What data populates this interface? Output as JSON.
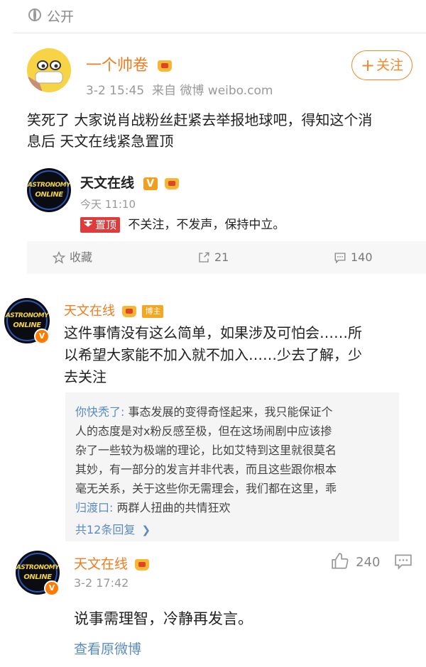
{
  "visibility": {
    "label": "公开"
  },
  "post": {
    "author": "一个帅卷",
    "time": "3-2 15:45",
    "source": "来自 微博 weibo.com",
    "follow_label": "关注",
    "text_line1": "笑死了 大家说肖战粉丝赶紧去举报地球吧，得知这个消",
    "text_line2": "息后 天文在线紧急置顶",
    "repost": {
      "author": "天文在线",
      "time": "今天 11:10",
      "pin_label": "置顶",
      "text": "不关注，不发声，保持中立。"
    },
    "actions": {
      "favorite": "收藏",
      "forward": "21",
      "comment": "140"
    }
  },
  "avatar_text": {
    "line1": "ASTRONOMY",
    "line2": "ONLINE"
  },
  "comment1": {
    "author": "天文在线",
    "badge": "博主",
    "line1": "这件事情没有这么简单，如果涉及可怕会……所",
    "line2": "以希望大家能不加入就不加入……少去了解，少",
    "line3": "去关注",
    "replies": {
      "reply1_author": "你快秃了:",
      "reply1_line1": " 事态发展的变得奇怪起来，我只能保证个",
      "reply1_line2": "人的态度是对x粉反感至极，但在这场闹剧中应该掺",
      "reply1_line3": "杂了一些较为极端的理论，比如艾特到这里就很莫名",
      "reply1_line4": "其妙，有一部分的发言并非代表，而且这些跟你根本",
      "reply1_line5": "毫无关系，关于这些你无需理会，我们都在这里，乖",
      "reply2_author": "归渡口:",
      "reply2_text": " 两群人扭曲的共情狂欢",
      "more": "共12条回复"
    }
  },
  "comment2": {
    "author": "天文在线",
    "time": "3-2 17:42",
    "likes": "240",
    "text": "说事需理智，冷静再发言。",
    "view_original": "查看原微博"
  },
  "colors": {
    "link": "#5a8bc5",
    "accent": "#f0892b",
    "pin": "#e03b3b",
    "badge": "#f5a623"
  }
}
